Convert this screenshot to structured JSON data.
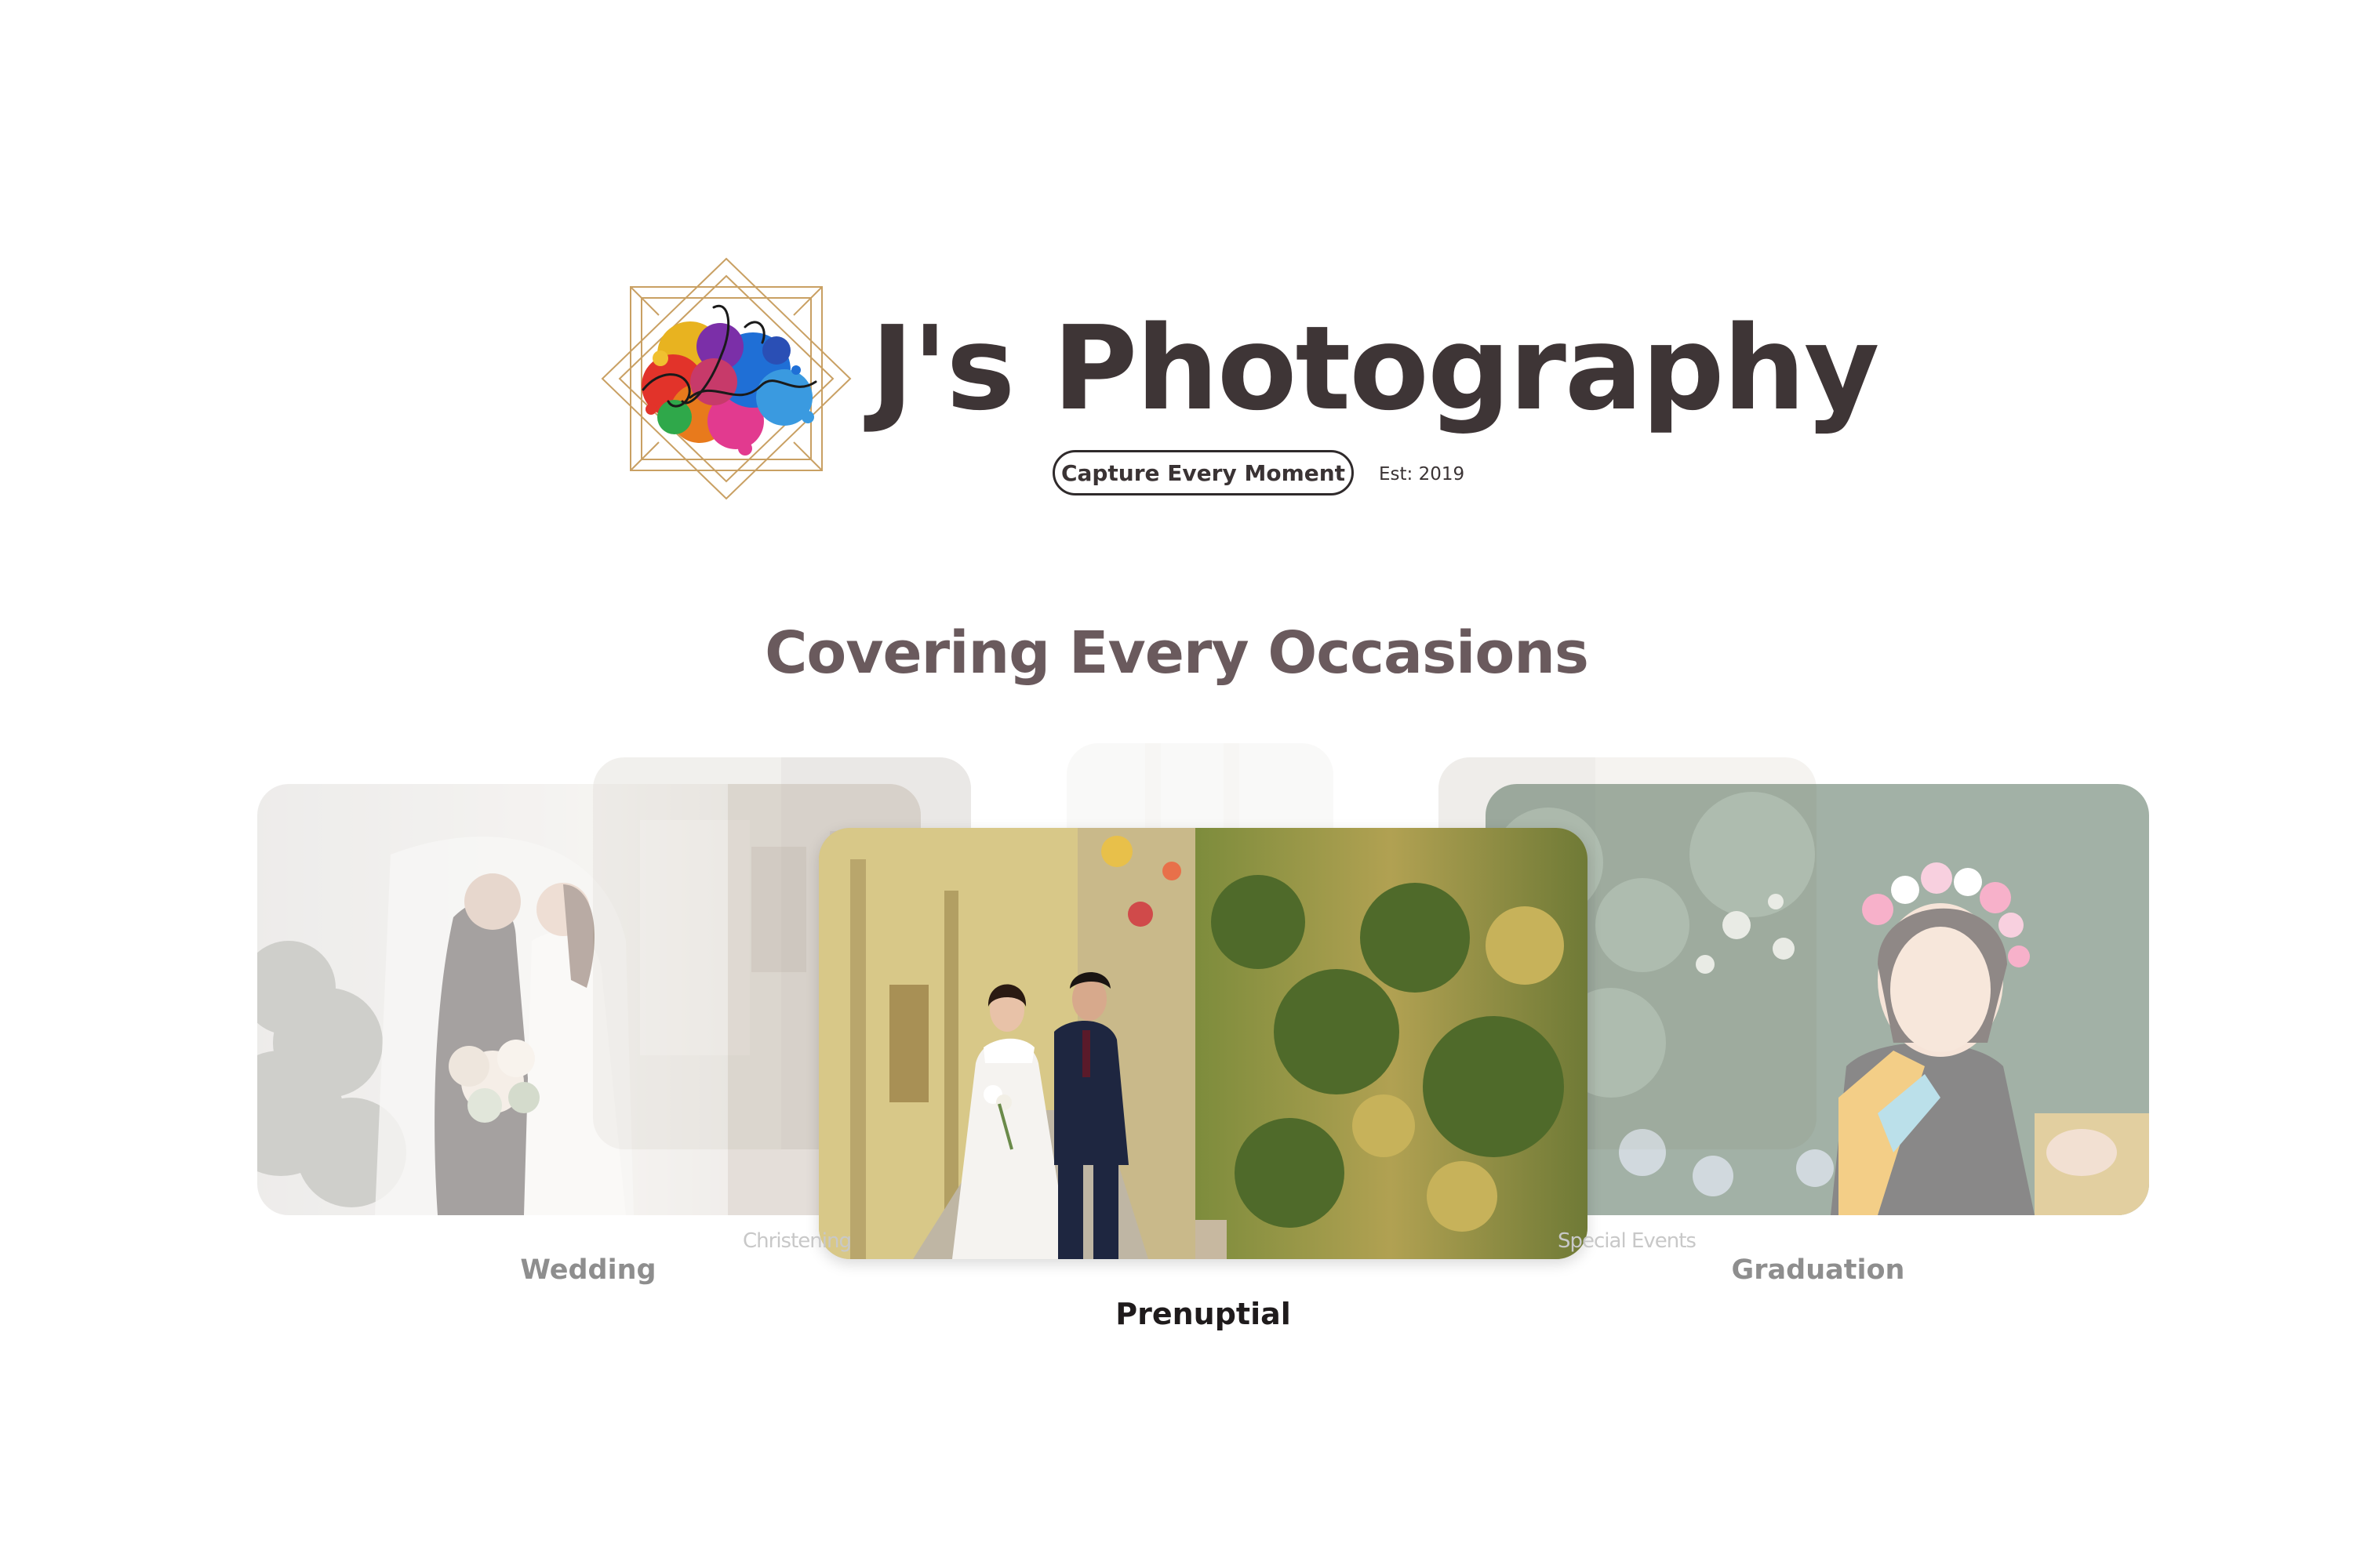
{
  "brand": {
    "name": "J's Photography",
    "tagline": "Capture Every Moment",
    "established": "Est: 2019",
    "logo_icon": "paint-splash-camera-logo"
  },
  "section": {
    "title": "Covering Every Occasions"
  },
  "carousel": {
    "active_index": 2,
    "slides": [
      {
        "label": "Wedding",
        "position": "left",
        "image": "couple-kissing-with-bouquet-photo"
      },
      {
        "label": "Christening",
        "position": "back-left",
        "image": "christening-photo"
      },
      {
        "label": "Prenuptial",
        "position": "center",
        "image": "couple-walking-in-alley-photo"
      },
      {
        "label": "Special Events",
        "position": "back-right",
        "image": "special-events-photo"
      },
      {
        "label": "Graduation",
        "position": "right",
        "image": "graduate-with-flower-crown-photo"
      }
    ]
  },
  "colors": {
    "title_text": "#3e3536",
    "section_title": "#6a5a5d",
    "active_caption": "#1f1b1c",
    "inactive_caption": "#8e8e8e"
  }
}
